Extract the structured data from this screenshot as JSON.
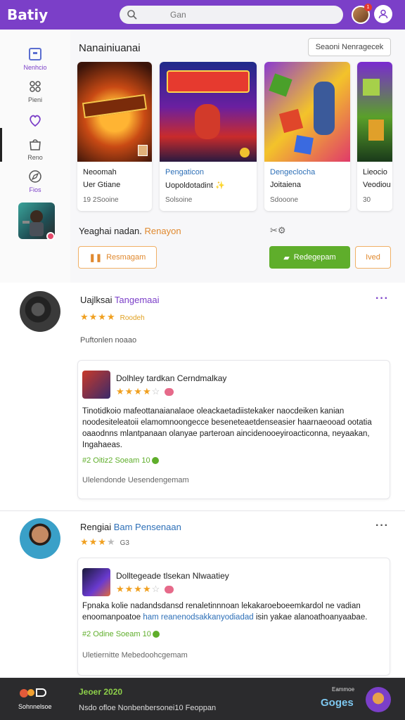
{
  "app": {
    "logo": "Batiy"
  },
  "search": {
    "placeholder": "Gan"
  },
  "notifications": {
    "count": "1"
  },
  "sidebar": {
    "items": [
      {
        "label": "Nenhcio",
        "icon": "home-square-icon"
      },
      {
        "label": "Pieni",
        "icon": "grid-icon"
      },
      {
        "label": "",
        "icon": "heart-icon"
      },
      {
        "label": "Reno",
        "icon": "bag-icon"
      },
      {
        "label": "Fios",
        "icon": "compass-icon"
      }
    ]
  },
  "games_section": {
    "title": "Nanainiuanai",
    "sort_label": "Seaoni Nenragecek",
    "games": [
      {
        "name1": "Neoomah",
        "name2": "Uer Gtiane",
        "meta": "19  2Sooine",
        "colors": [
          "#f59a23",
          "#7a1f0a"
        ]
      },
      {
        "name1": "Pengaticon",
        "name2": "Uopoldotadint ✨",
        "meta": "Solsoine",
        "colors": [
          "#3b4bd0",
          "#c8262b"
        ]
      },
      {
        "name1": "Dengeclocha",
        "name2": "Joitaiena",
        "meta": "Sdooone",
        "colors": [
          "#7ad04a",
          "#e03a8a"
        ]
      },
      {
        "name1": "Lieocio",
        "name2": "Veodiou",
        "meta": "30",
        "colors": [
          "#5aa02a",
          "#8a2ad0"
        ]
      }
    ]
  },
  "recommendation": {
    "text": "Yeaghai nadan.",
    "accent": "Renayon",
    "btn_left": "Resmagam",
    "btn_green": "Redegepam",
    "btn_right": "Ived"
  },
  "posts": [
    {
      "name": "Uajlksai",
      "name_accent": "Tangemaai",
      "rating": "★★★★",
      "rating_off": "",
      "rating_tag": "Roodeh",
      "subtitle": "Puftonlen noaao",
      "review": {
        "title": "Dolhley tardkan Cerndmalkay",
        "stars": "★★★★",
        "stars_off": "☆",
        "body_line1": "Tinotidkoio mafeottanaianalaoe oleackaetadiistekaker naocdeiken kanian",
        "body_line2": "noodesiteleatoii elamomnoongecce beseneteaetdenseasier haarnaeooad ootatia",
        "body_line3": "oaaodnns mlantpanaan olanyae parteroan aincidenooeyiroacticonna, neyaakan,",
        "body_line4": "Ingahaeas.",
        "tags": "#2 Oitiz2 Soeam  10",
        "footer": "Ulelendonde Uesendengemam"
      }
    },
    {
      "name": "Rengiai",
      "name_accent": "Bam Pensenaan",
      "rating": "★★★",
      "rating_off": "★",
      "rating_tag": "G3",
      "subtitle": "",
      "review": {
        "title": "Dolltegeade tlsekan Nlwaatiey",
        "stars": "★★★★",
        "stars_off": "☆",
        "body_line1": "Fpnaka kolie nadandsdansd renaletinnnoan lekakaroeboeemkardol ne vadian",
        "body_line2_pre": "enoomanpoatoe",
        "body_line2_link": "ham reanenodsakkanyodiadad",
        "body_line2_post": "isin yakae alanoathoanyaabae.",
        "tags": "#2 Odine Soeam  10",
        "footer": "Uletiernitte Mebedoohcgemam"
      }
    }
  ],
  "footer": {
    "logo_text": "Sohnnelsoe",
    "date": "Jeoer 2020",
    "note": "Nsdo  ofloe Nonbenbersonei10 Feoppan",
    "small": "Eammoe",
    "brand": "Goges"
  },
  "colors": {
    "brand": "#7b3fc8",
    "green": "#5fae2b",
    "orange": "#e0892e",
    "footer": "#2b2b2d"
  }
}
